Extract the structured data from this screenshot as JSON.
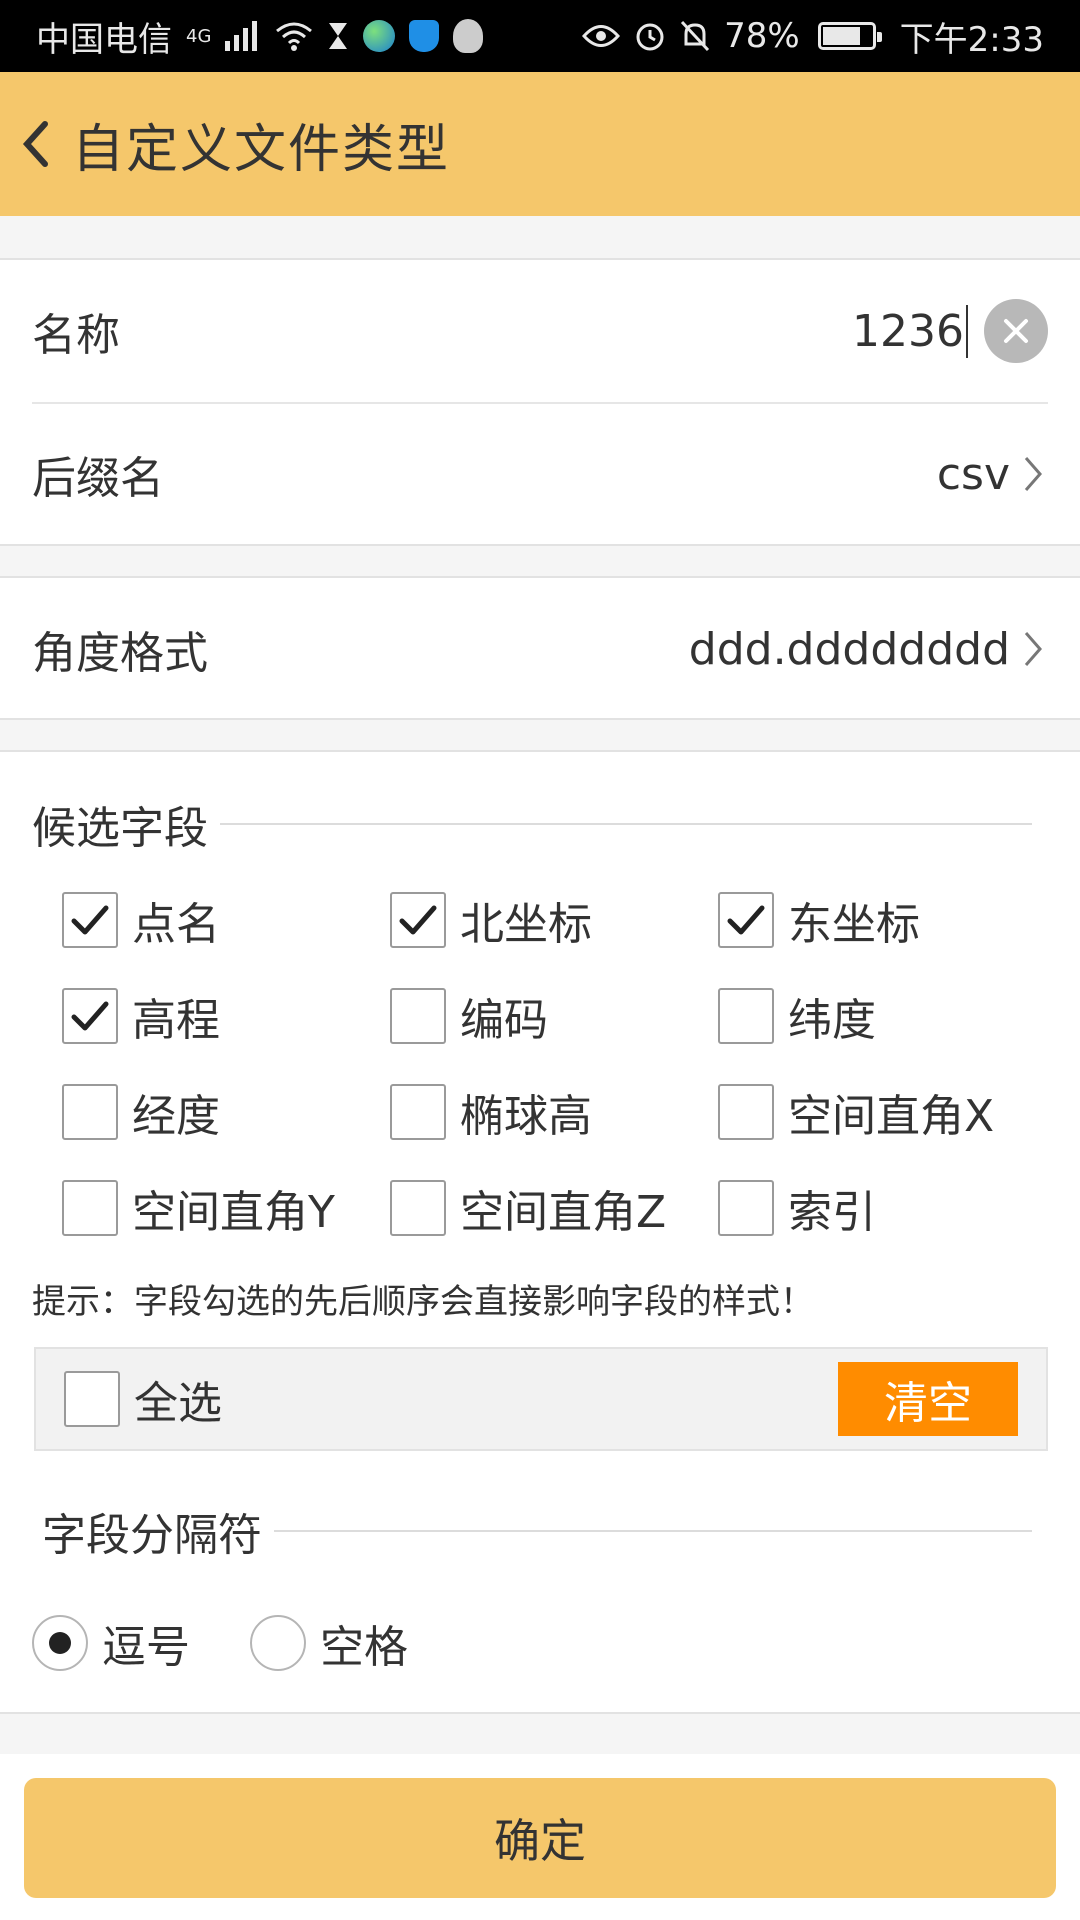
{
  "status_bar": {
    "carrier": "中国电信",
    "network": "4G",
    "battery": "78%",
    "battery_level": 0.78,
    "time": "下午2:33"
  },
  "header": {
    "title": "自定义文件类型"
  },
  "form": {
    "name_label": "名称",
    "name_value": "1236",
    "suffix_label": "后缀名",
    "suffix_value": "csv",
    "angle_label": "角度格式",
    "angle_value": "ddd.dddddddd"
  },
  "fields": {
    "title": "候选字段",
    "items": [
      {
        "label": "点名",
        "checked": true
      },
      {
        "label": "北坐标",
        "checked": true
      },
      {
        "label": "东坐标",
        "checked": true
      },
      {
        "label": "高程",
        "checked": true
      },
      {
        "label": "编码",
        "checked": false
      },
      {
        "label": "纬度",
        "checked": false
      },
      {
        "label": "经度",
        "checked": false
      },
      {
        "label": "椭球高",
        "checked": false
      },
      {
        "label": "空间直角X",
        "checked": false
      },
      {
        "label": "空间直角Y",
        "checked": false
      },
      {
        "label": "空间直角Z",
        "checked": false
      },
      {
        "label": "索引",
        "checked": false
      }
    ],
    "hint": "提示：字段勾选的先后顺序会直接影响字段的样式！",
    "select_all_label": "全选",
    "clear_label": "清空"
  },
  "separator": {
    "title": "字段分隔符",
    "options": [
      {
        "label": "逗号",
        "selected": true
      },
      {
        "label": "空格",
        "selected": false
      }
    ]
  },
  "confirm_label": "确定",
  "colors": {
    "header": "#f5c76b",
    "accent_orange": "#ff8c00"
  }
}
